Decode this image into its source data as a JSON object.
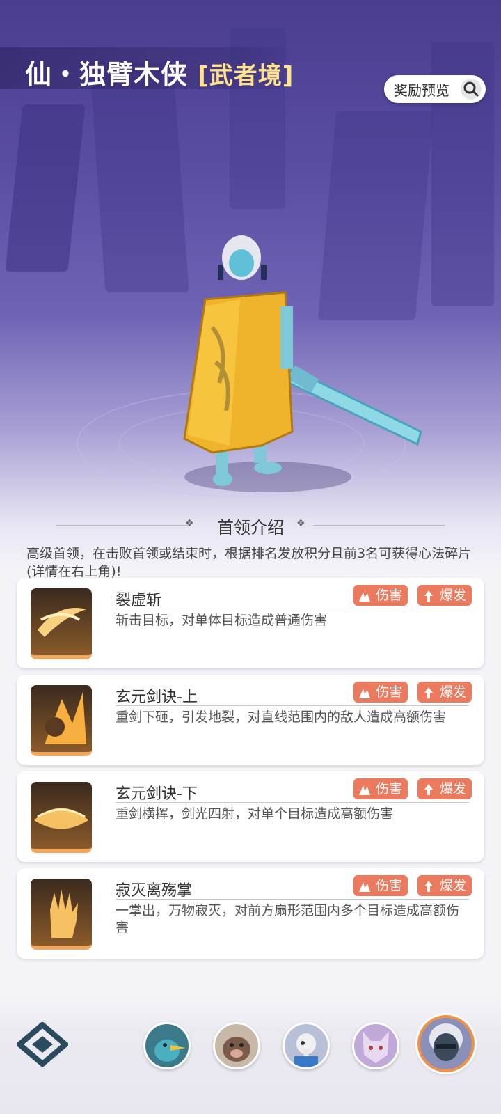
{
  "boss": {
    "name": "仙・独臂木侠",
    "rank": "[武者境]"
  },
  "reward_preview": {
    "label": "奖励预览",
    "icon": "search-icon"
  },
  "section": {
    "title": "首领介绍",
    "intro": "高级首领，在击败首领或结束时，根据排名发放积分且前3名可获得心法碎片(详情在右上角)!"
  },
  "skills": [
    {
      "name": "裂虚斩",
      "desc": "斩击目标，对单体目标造成普通伤害",
      "tags": [
        "伤害",
        "爆发"
      ],
      "icon": "slash-skill-icon"
    },
    {
      "name": "玄元剑诀-上",
      "desc": "重剑下砸，引发地裂，对直线范围内的敌人造成高额伤害",
      "tags": [
        "伤害",
        "爆发"
      ],
      "icon": "ground-smash-skill-icon"
    },
    {
      "name": "玄元剑诀-下",
      "desc": "重剑横挥，剑光四射，对单个目标造成高额伤害",
      "tags": [
        "伤害",
        "爆发"
      ],
      "icon": "sword-sweep-skill-icon"
    },
    {
      "name": "寂灭离殇掌",
      "desc": "一掌出，万物寂灭，对前方扇形范围内多个目标造成高额伤害",
      "tags": [
        "伤害",
        "爆发"
      ],
      "icon": "palm-skill-icon"
    }
  ],
  "boss_selector": [
    {
      "icon": "blue-bird-boss-avatar",
      "selected": false
    },
    {
      "icon": "boar-boss-avatar",
      "selected": false
    },
    {
      "icon": "skull-bird-boss-avatar",
      "selected": false
    },
    {
      "icon": "wolf-boss-avatar",
      "selected": false
    },
    {
      "icon": "one-armed-swordsman-avatar",
      "selected": true
    }
  ],
  "colors": {
    "tag_bg": "#ec7a5e",
    "rank_text": "#ffe28a",
    "selected_ring": "#f0914a"
  }
}
